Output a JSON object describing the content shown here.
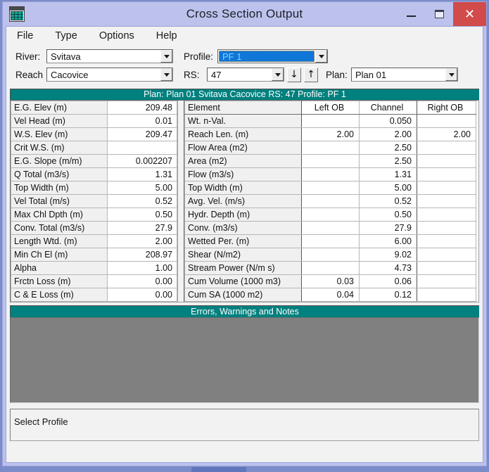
{
  "window": {
    "title": "Cross Section Output",
    "icon": "table-grid-icon",
    "controls": {
      "minimize": "—",
      "maximize": "❐",
      "close": "✕"
    }
  },
  "menu": {
    "items": [
      "File",
      "Type",
      "Options",
      "Help"
    ]
  },
  "selectors": {
    "river": {
      "label": "River:",
      "value": "Svitava"
    },
    "reach": {
      "label": "Reach",
      "value": "Cacovice"
    },
    "profile": {
      "label": "Profile:",
      "value": "PF 1",
      "selected": true
    },
    "rs": {
      "label": "RS:",
      "value": "47"
    },
    "plan": {
      "label": "Plan:",
      "value": "Plan 01"
    },
    "nav_down": "↓",
    "nav_up": "↑"
  },
  "banner": {
    "text": "Plan: Plan 01    Svitava    Cacovice  RS: 47    Profile: PF 1"
  },
  "left_table": {
    "rows": [
      {
        "label": "E.G. Elev (m)",
        "value": "209.48"
      },
      {
        "label": "Vel Head (m)",
        "value": "0.01"
      },
      {
        "label": "W.S. Elev (m)",
        "value": "209.47"
      },
      {
        "label": "Crit W.S. (m)",
        "value": ""
      },
      {
        "label": "E.G. Slope (m/m)",
        "value": "0.002207"
      },
      {
        "label": "Q Total (m3/s)",
        "value": "1.31"
      },
      {
        "label": "Top Width (m)",
        "value": "5.00"
      },
      {
        "label": "Vel Total (m/s)",
        "value": "0.52"
      },
      {
        "label": "Max Chl Dpth (m)",
        "value": "0.50"
      },
      {
        "label": "Conv. Total (m3/s)",
        "value": "27.9"
      },
      {
        "label": "Length Wtd. (m)",
        "value": "2.00"
      },
      {
        "label": "Min Ch El (m)",
        "value": "208.97"
      },
      {
        "label": "Alpha",
        "value": "1.00"
      },
      {
        "label": "Frctn Loss (m)",
        "value": "0.00"
      },
      {
        "label": "C & E Loss (m)",
        "value": "0.00"
      }
    ]
  },
  "right_table": {
    "headers": [
      "Element",
      "Left OB",
      "Channel",
      "Right OB"
    ],
    "rows": [
      {
        "element": "Wt. n-Val.",
        "left_ob": "",
        "channel": "0.050",
        "right_ob": ""
      },
      {
        "element": "Reach Len. (m)",
        "left_ob": "2.00",
        "channel": "2.00",
        "right_ob": "2.00"
      },
      {
        "element": "Flow Area (m2)",
        "left_ob": "",
        "channel": "2.50",
        "right_ob": ""
      },
      {
        "element": "Area (m2)",
        "left_ob": "",
        "channel": "2.50",
        "right_ob": ""
      },
      {
        "element": "Flow (m3/s)",
        "left_ob": "",
        "channel": "1.31",
        "right_ob": ""
      },
      {
        "element": "Top Width (m)",
        "left_ob": "",
        "channel": "5.00",
        "right_ob": ""
      },
      {
        "element": "Avg. Vel. (m/s)",
        "left_ob": "",
        "channel": "0.52",
        "right_ob": ""
      },
      {
        "element": "Hydr. Depth (m)",
        "left_ob": "",
        "channel": "0.50",
        "right_ob": ""
      },
      {
        "element": "Conv. (m3/s)",
        "left_ob": "",
        "channel": "27.9",
        "right_ob": ""
      },
      {
        "element": "Wetted Per. (m)",
        "left_ob": "",
        "channel": "6.00",
        "right_ob": ""
      },
      {
        "element": "Shear (N/m2)",
        "left_ob": "",
        "channel": "9.02",
        "right_ob": ""
      },
      {
        "element": "Stream Power (N/m s)",
        "left_ob": "",
        "channel": "4.73",
        "right_ob": ""
      },
      {
        "element": "Cum Volume (1000 m3)",
        "left_ob": "0.03",
        "channel": "0.06",
        "right_ob": ""
      },
      {
        "element": "Cum SA (1000 m2)",
        "left_ob": "0.04",
        "channel": "0.12",
        "right_ob": ""
      }
    ]
  },
  "errors_panel": {
    "title": "Errors, Warnings and Notes",
    "content": ""
  },
  "statusbar": {
    "text": "Select Profile"
  },
  "colors": {
    "titlebar": "#bcc2ec",
    "teal_banner": "#00807e",
    "close_red": "#d14b4b",
    "errors_gray": "#808080",
    "selection_blue": "#1076d8",
    "desktop": "#7b8cc8"
  }
}
